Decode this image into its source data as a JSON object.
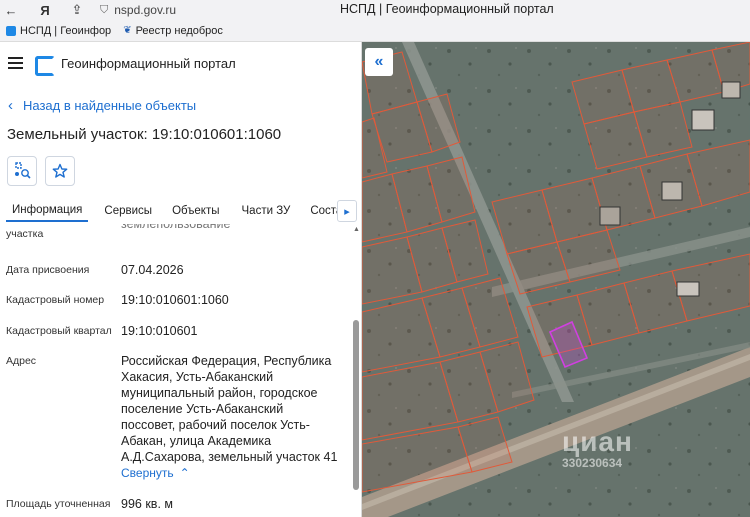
{
  "browser": {
    "url": "nspd.gov.ru",
    "title": "НСПД | Геоинформационный портал",
    "yandex_label": "Я"
  },
  "bookmarks": [
    {
      "label": "НСПД | Геоинфор"
    },
    {
      "label": "Реестр недоброс"
    }
  ],
  "header": {
    "title": "Геоинформационный портал"
  },
  "back_link": {
    "label": "Назад в найденные объекты"
  },
  "page_title": "Земельный участок: 19:10:010601:1060",
  "tabs": [
    {
      "label": "Информация",
      "active": true
    },
    {
      "label": "Сервисы"
    },
    {
      "label": "Объекты"
    },
    {
      "label": "Части ЗУ"
    },
    {
      "label": "Состав"
    }
  ],
  "properties": {
    "partial_top_label": "участка",
    "partial_top_value": "землепользование",
    "date": {
      "label": "Дата присвоения",
      "value": "07.04.2026"
    },
    "cad_number": {
      "label": "Кадастровый номер",
      "value": "19:10:010601:1060"
    },
    "cad_quarter": {
      "label": "Кадастровый квартал",
      "value": "19:10:010601"
    },
    "address": {
      "label": "Адрес",
      "lines": [
        "Российская Федерация, Республика",
        "Хакасия, Усть-Абаканский",
        "муниципальный район, городское",
        "поселение Усть-Абаканский",
        "поссовет, рабочий поселок Усть-",
        "Абакан, улица Академика",
        "А.Д.Сахарова, земельный участок 41"
      ],
      "collapse_label": "Свернуть"
    },
    "area": {
      "label": "Площадь уточненная",
      "value": "996 кв. м"
    }
  },
  "map": {
    "watermark": "циан",
    "watermark_id": "330230634",
    "parcel_color": "#d040e0",
    "boundary_color": "#e05a3a"
  }
}
